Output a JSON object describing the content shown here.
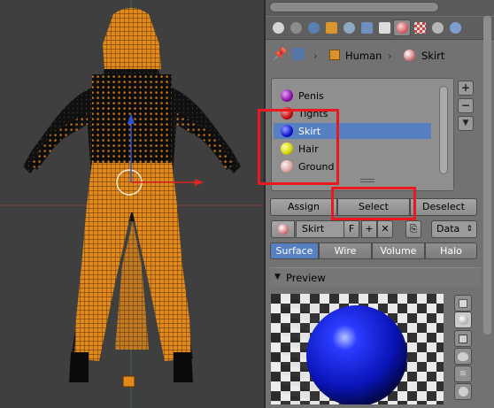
{
  "viewport": {
    "label": "3D viewport - Human mesh in edit mode"
  },
  "properties": {
    "context_tabs": [
      "render-icon",
      "scene-icon",
      "world-icon",
      "object-icon",
      "constraints-icon",
      "modifiers-icon",
      "data-icon",
      "material-icon",
      "texture-icon",
      "particles-icon",
      "physics-icon"
    ],
    "active_tab": "material-icon",
    "breadcrumb": {
      "object": "Human",
      "material": "Skirt"
    },
    "material_slots": [
      {
        "name": "Penis",
        "color": "#8a12a8"
      },
      {
        "name": "Tights",
        "color": "#c20d0d"
      },
      {
        "name": "Skirt",
        "color": "#0d15d2"
      },
      {
        "name": "Hair",
        "color": "#d4d40a"
      },
      {
        "name": "Ground",
        "color": "#d9a2a2"
      }
    ],
    "selected_slot": "Skirt",
    "slot_buttons": {
      "add": "+",
      "remove": "−",
      "menu": "▼"
    },
    "actions": {
      "assign": "Assign",
      "select": "Select",
      "deselect": "Deselect"
    },
    "material_field": {
      "name": "Skirt",
      "fake_user": "F",
      "add": "+",
      "unlink": "✕"
    },
    "link_select": "Data",
    "preview_tabs": [
      "Surface",
      "Wire",
      "Volume",
      "Halo"
    ],
    "active_preview_tab": "Surface",
    "preview_panel": {
      "title": "Preview"
    },
    "preview_buttons": [
      "plane-icon",
      "sphere-icon",
      "cube-icon",
      "monkey-icon",
      "hair-icon",
      "sky-icon"
    ],
    "active_preview_button": "sphere-icon"
  }
}
